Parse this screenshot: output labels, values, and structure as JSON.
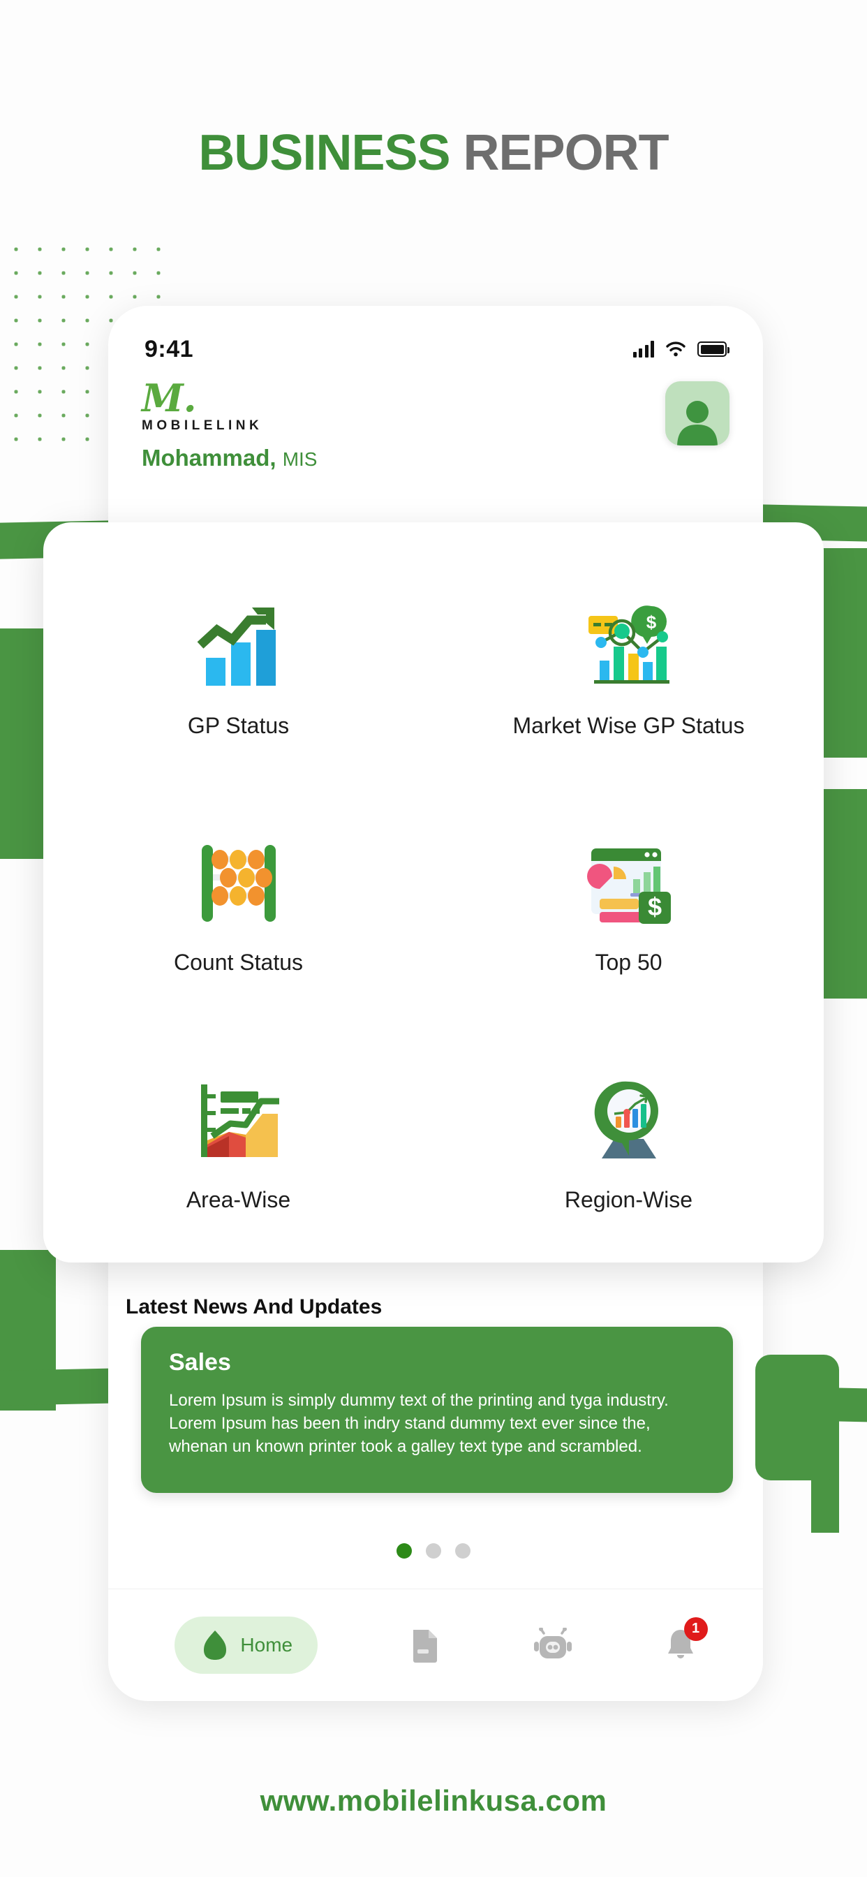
{
  "poster": {
    "title_primary": "BUSINESS",
    "title_secondary": "REPORT",
    "footer_url": "www.mobilelinkusa.com",
    "colors": {
      "green": "#4a9543",
      "title_green": "#3f8f3a",
      "title_gray": "#6e6e6e",
      "badge_red": "#e01b1b"
    }
  },
  "statusbar": {
    "time": "9:41",
    "signal_icon": "cellular-signal-icon",
    "wifi_icon": "wifi-icon",
    "battery_icon": "battery-full-icon"
  },
  "header": {
    "logo_mark": "M.",
    "logo_wordmark": "MOBILELINK",
    "user_name": "Mohammad,",
    "user_role": "MIS",
    "avatar_icon": "user-avatar-icon"
  },
  "menu": {
    "items": [
      {
        "label": "GP Status",
        "icon": "growth-bar-chart-icon"
      },
      {
        "label": "Market Wise GP Status",
        "icon": "market-analysis-icon"
      },
      {
        "label": "Count Status",
        "icon": "abacus-icon"
      },
      {
        "label": "Top 50",
        "icon": "dashboard-report-icon"
      },
      {
        "label": "Area-Wise",
        "icon": "area-chart-icon"
      },
      {
        "label": "Region-Wise",
        "icon": "map-pin-chart-icon"
      }
    ]
  },
  "news": {
    "section_title": "Latest News And Updates",
    "card_title": "Sales",
    "card_body": "Lorem Ipsum is simply dummy text of the printing and tyga industry. Lorem Ipsum has been th indry stand dummy text ever since the, whenan un known printer took a galley text type and scrambled.",
    "pagination": {
      "total": 3,
      "active_index": 0
    }
  },
  "bottomnav": {
    "items": [
      {
        "label": "Home",
        "icon": "home-icon",
        "active": true,
        "badge": ""
      },
      {
        "label": "",
        "icon": "document-icon",
        "active": false,
        "badge": ""
      },
      {
        "label": "",
        "icon": "robot-icon",
        "active": false,
        "badge": ""
      },
      {
        "label": "",
        "icon": "bell-icon",
        "active": false,
        "badge": "1"
      }
    ]
  }
}
